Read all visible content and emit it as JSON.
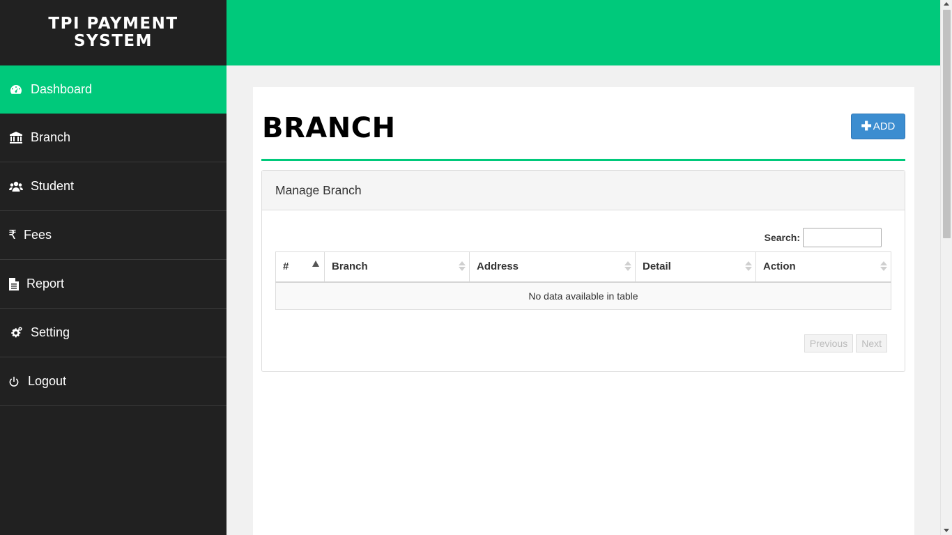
{
  "app": {
    "brand": "TPI PAYMENT SYSTEM"
  },
  "sidebar": {
    "items": [
      {
        "label": "Dashboard",
        "icon": "dashboard-icon",
        "active": true
      },
      {
        "label": "Branch",
        "icon": "bank-icon"
      },
      {
        "label": "Student",
        "icon": "users-icon"
      },
      {
        "label": "Fees",
        "icon": "rupee-icon"
      },
      {
        "label": "Report",
        "icon": "file-icon"
      },
      {
        "label": "Setting",
        "icon": "gears-icon"
      },
      {
        "label": "Logout",
        "icon": "power-icon"
      }
    ]
  },
  "page": {
    "title": "BRANCH",
    "add_label": "ADD"
  },
  "panel": {
    "heading": "Manage Branch",
    "search_label": "Search:",
    "search_value": "",
    "columns": [
      "#",
      "Branch",
      "Address",
      "Detail",
      "Action"
    ],
    "empty_text": "No data available in table",
    "prev_label": "Previous",
    "next_label": "Next"
  },
  "colors": {
    "accent": "#00c97b",
    "sidebar_bg": "#212121",
    "add_button": "#3c8dd0"
  }
}
